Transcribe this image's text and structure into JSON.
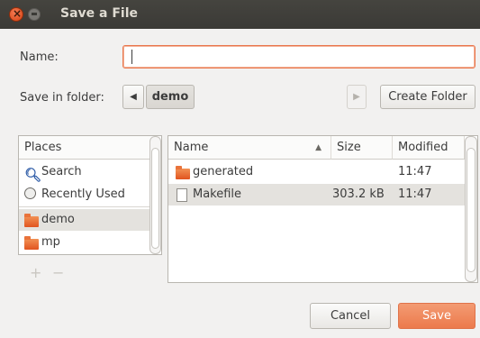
{
  "window": {
    "title": "Save a File"
  },
  "form": {
    "name_label": "Name:",
    "name_value": "",
    "folder_label": "Save in folder:",
    "path_current": "demo",
    "create_folder_label": "Create Folder"
  },
  "places": {
    "header": "Places",
    "items": [
      {
        "label": "Search",
        "icon": "search-icon"
      },
      {
        "label": "Recently Used",
        "icon": "recent-icon"
      },
      {
        "label": "demo",
        "icon": "folder-icon"
      },
      {
        "label": "mp",
        "icon": "folder-icon"
      }
    ],
    "add_symbol": "+",
    "remove_symbol": "−"
  },
  "files": {
    "columns": {
      "name": "Name",
      "size": "Size",
      "modified": "Modified"
    },
    "sort_indicator": "▲",
    "rows": [
      {
        "name": "generated",
        "size": "",
        "modified": "11:47",
        "icon": "folder-icon"
      },
      {
        "name": "Makefile",
        "size": "303.2 kB",
        "modified": "11:47",
        "icon": "file-icon"
      }
    ]
  },
  "buttons": {
    "cancel": "Cancel",
    "save": "Save"
  },
  "colors": {
    "accent": "#ec7a4c",
    "titlebar": "#3b3a36"
  }
}
